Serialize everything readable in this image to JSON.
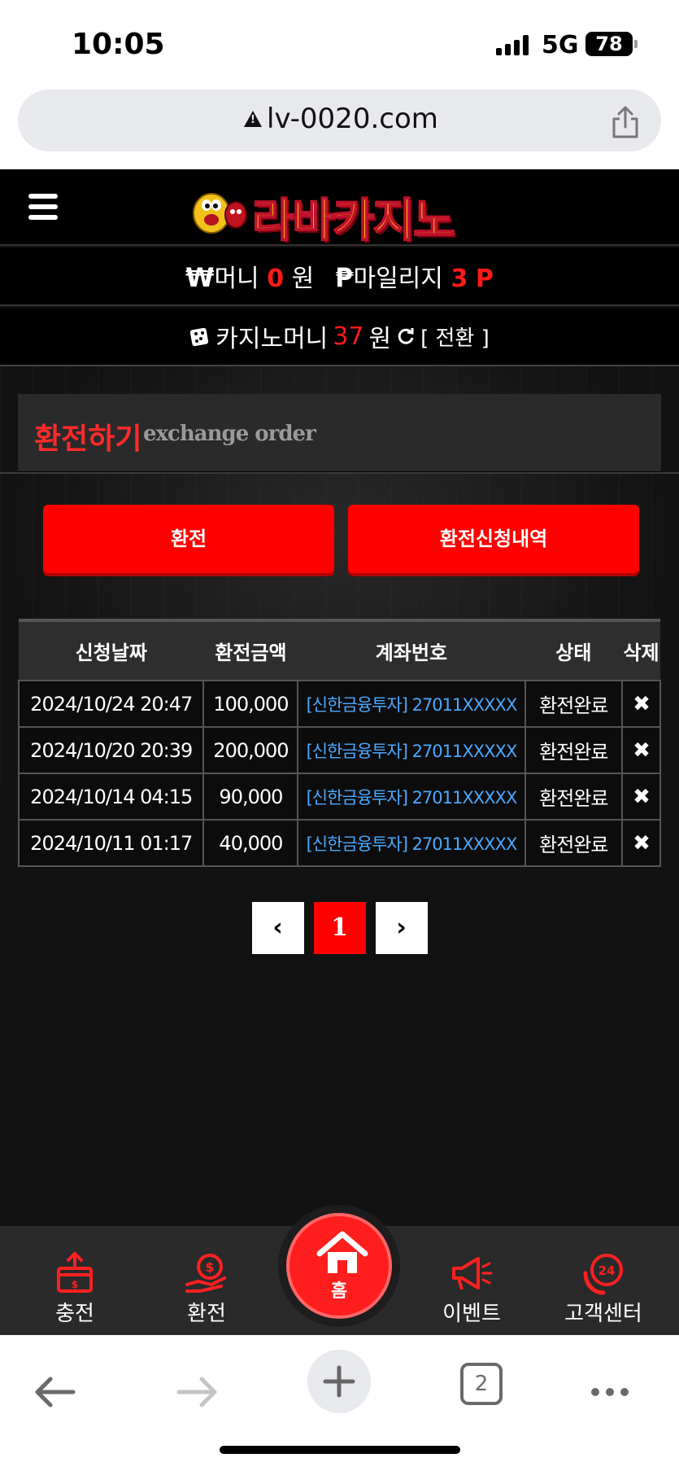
{
  "status_bar": {
    "time": "10:05",
    "network": "5G",
    "battery": "78"
  },
  "browser": {
    "url": "lv-0020.com",
    "tab_count": "2"
  },
  "site": {
    "logo_text": "라바카지노",
    "money": {
      "symbol": "₩",
      "label": "머니",
      "value": "0",
      "unit": "원"
    },
    "mileage": {
      "symbol": "₱",
      "label": "마일리지",
      "value": "3",
      "unit": "P"
    },
    "casino": {
      "label": "카지노머니",
      "value": "37",
      "unit": "원",
      "convert_label": "[ 전환 ]"
    },
    "section_title": {
      "korean": "환전하기",
      "english": "exchange order"
    },
    "buttons": {
      "exchange": "환전",
      "history": "환전신청내역"
    },
    "table": {
      "headers": [
        "신청날짜",
        "환전금액",
        "계좌번호",
        "상태",
        "삭제"
      ],
      "rows": [
        {
          "date": "2024/10/24 20:47",
          "amount": "100,000",
          "account": "[신한금융투자] 27011XXXXX",
          "status": "환전완료",
          "delete": "✖"
        },
        {
          "date": "2024/10/20 20:39",
          "amount": "200,000",
          "account": "[신한금융투자] 27011XXXXX",
          "status": "환전완료",
          "delete": "✖"
        },
        {
          "date": "2024/10/14 04:15",
          "amount": "90,000",
          "account": "[신한금융투자] 27011XXXXX",
          "status": "환전완료",
          "delete": "✖"
        },
        {
          "date": "2024/10/11 01:17",
          "amount": "40,000",
          "account": "[신한금융투자] 27011XXXXX",
          "status": "환전완료",
          "delete": "✖"
        }
      ]
    },
    "pagination": {
      "prev": "‹",
      "current": "1",
      "next": "›"
    },
    "bottom_nav": {
      "charge": "충전",
      "exchange": "환전",
      "home": "홈",
      "event": "이벤트",
      "support": "고객센터"
    }
  },
  "colors": {
    "accent": "#ff0000",
    "link": "#4aa8ff",
    "background": "#121212"
  }
}
